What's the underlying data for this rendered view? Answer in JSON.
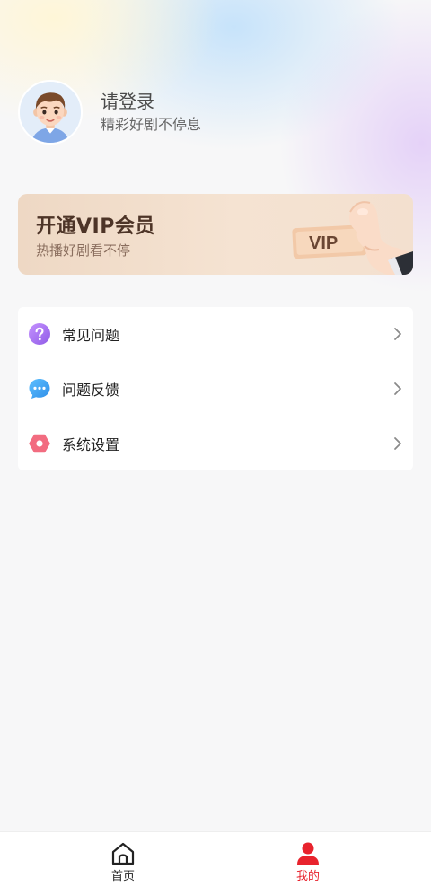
{
  "profile": {
    "title": "请登录",
    "subtitle": "精彩好剧不停息",
    "avatar_icon": "boy-avatar"
  },
  "vip": {
    "title": "开通VIP会员",
    "subtitle": "热播好剧看不停",
    "badge": "VIP",
    "colors": {
      "card": "#f3e0cf",
      "title": "#4d3427",
      "subtitle": "#8a6e5e"
    }
  },
  "menu": {
    "items": [
      {
        "label": "常见问题",
        "icon": "question-icon",
        "icon_color": "#a36ff0"
      },
      {
        "label": "问题反馈",
        "icon": "chat-bubble-icon",
        "icon_color": "#3ca0f0"
      },
      {
        "label": "系统设置",
        "icon": "settings-hexagon-icon",
        "icon_color": "#f0697a"
      }
    ]
  },
  "tabbar": {
    "tabs": [
      {
        "label": "首页",
        "icon": "home-icon",
        "active": false
      },
      {
        "label": "我的",
        "icon": "user-icon",
        "active": true
      }
    ],
    "active_color": "#e8232d"
  }
}
